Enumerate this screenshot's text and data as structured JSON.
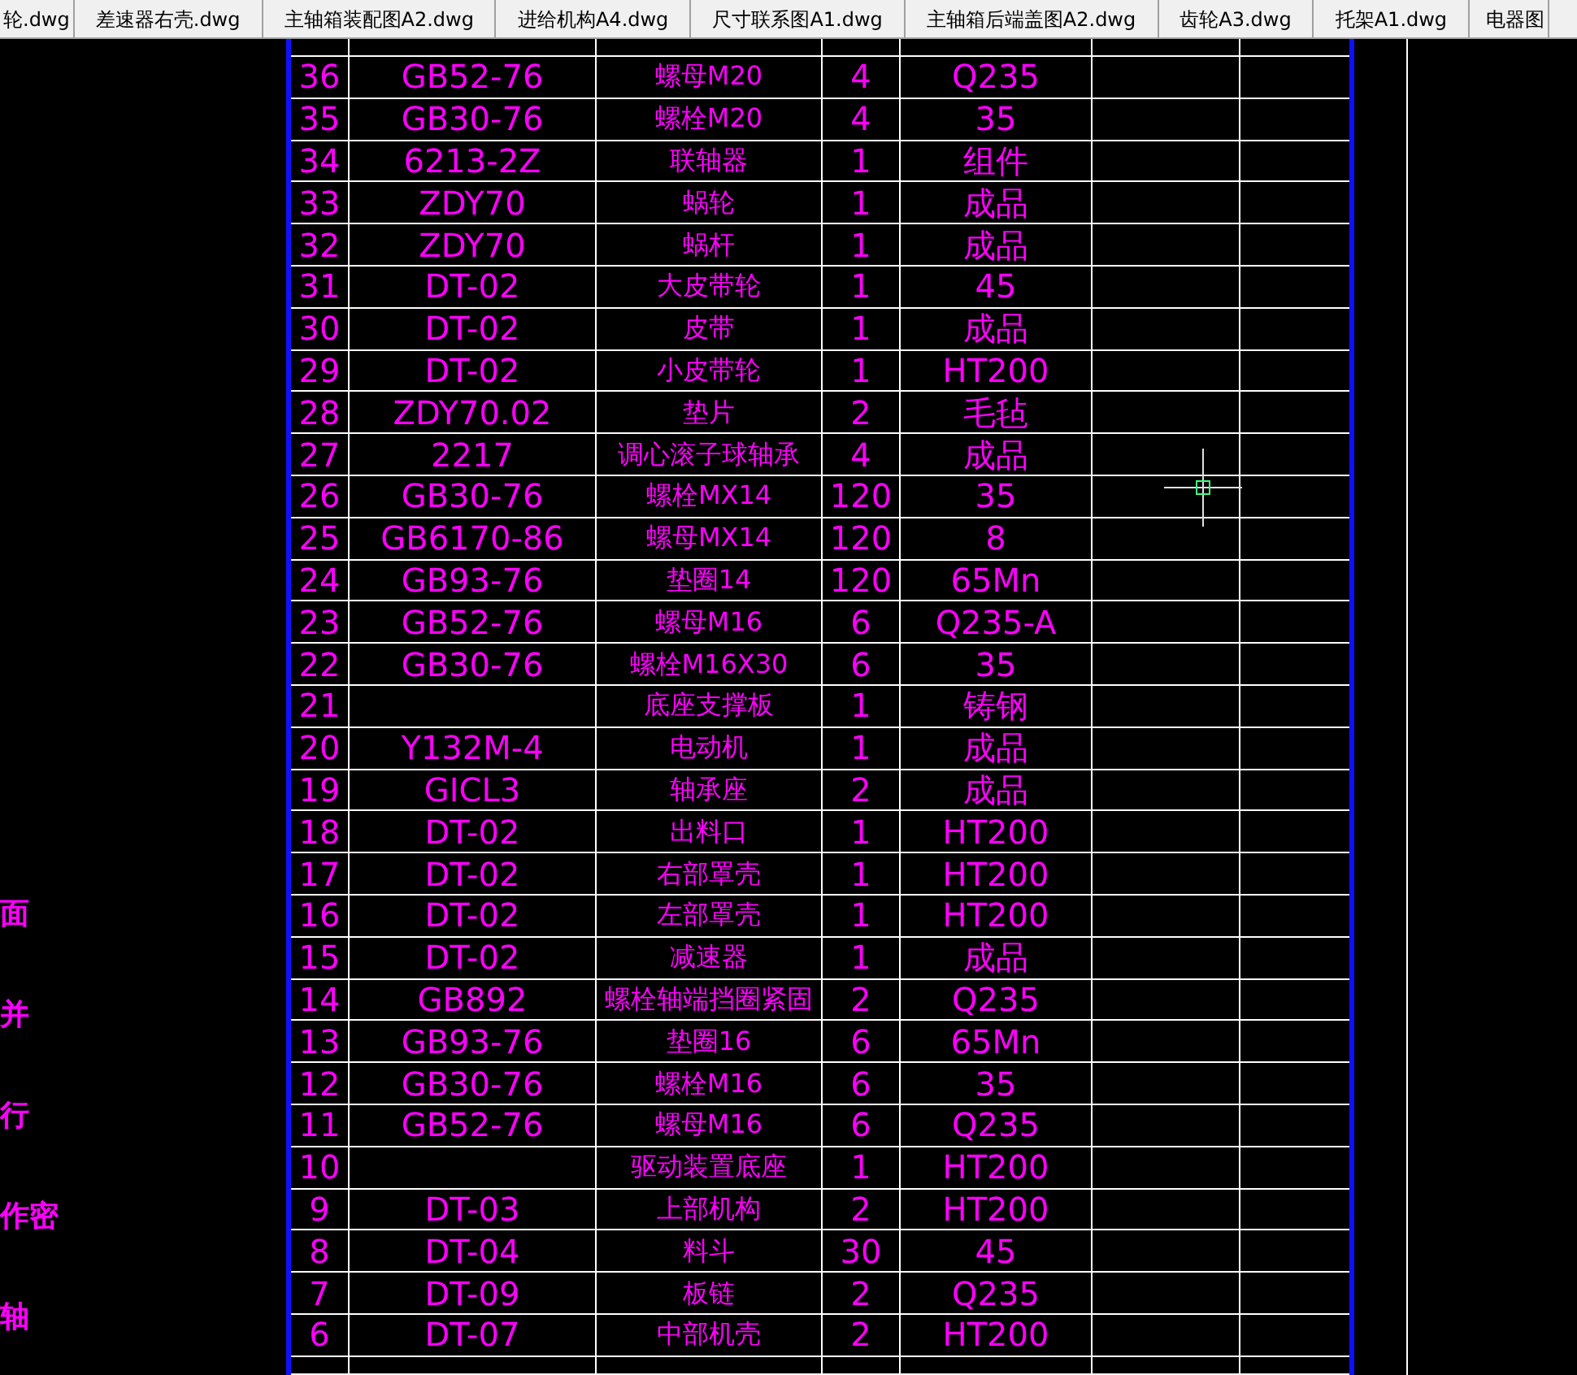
{
  "tabs": [
    {
      "label": "轮.dwg"
    },
    {
      "label": "差速器右壳.dwg"
    },
    {
      "label": "主轴箱装配图A2.dwg"
    },
    {
      "label": "进给机构A4.dwg"
    },
    {
      "label": "尺寸联系图A1.dwg"
    },
    {
      "label": "主轴箱后端盖图A2.dwg"
    },
    {
      "label": "齿轮A3.dwg"
    },
    {
      "label": "托架A1.dwg"
    },
    {
      "label": "电器图"
    }
  ],
  "margin_texts": [
    "面",
    "并",
    "行",
    "作密",
    "轴"
  ],
  "parts_table": {
    "rows": [
      {
        "no": "36",
        "code": "GB52-76",
        "name": "螺母M20",
        "qty": "4",
        "material": "Q235"
      },
      {
        "no": "35",
        "code": "GB30-76",
        "name": "螺栓M20",
        "qty": "4",
        "material": "35"
      },
      {
        "no": "34",
        "code": "6213-2Z",
        "name": "联轴器",
        "qty": "1",
        "material": "组件"
      },
      {
        "no": "33",
        "code": "ZDY70",
        "name": "蜗轮",
        "qty": "1",
        "material": "成品"
      },
      {
        "no": "32",
        "code": "ZDY70",
        "name": "蜗杆",
        "qty": "1",
        "material": "成品"
      },
      {
        "no": "31",
        "code": "DT-02",
        "name": "大皮带轮",
        "qty": "1",
        "material": "45"
      },
      {
        "no": "30",
        "code": "DT-02",
        "name": "皮带",
        "qty": "1",
        "material": "成品"
      },
      {
        "no": "29",
        "code": "DT-02",
        "name": "小皮带轮",
        "qty": "1",
        "material": "HT200"
      },
      {
        "no": "28",
        "code": "ZDY70.02",
        "name": "垫片",
        "qty": "2",
        "material": "毛毡"
      },
      {
        "no": "27",
        "code": "2217",
        "name": "调心滚子球轴承",
        "qty": "4",
        "material": "成品"
      },
      {
        "no": "26",
        "code": "GB30-76",
        "name": "螺栓MX14",
        "qty": "120",
        "material": "35"
      },
      {
        "no": "25",
        "code": "GB6170-86",
        "name": "螺母MX14",
        "qty": "120",
        "material": "8"
      },
      {
        "no": "24",
        "code": "GB93-76",
        "name": "垫圈14",
        "qty": "120",
        "material": "65Mn"
      },
      {
        "no": "23",
        "code": "GB52-76",
        "name": "螺母M16",
        "qty": "6",
        "material": "Q235-A"
      },
      {
        "no": "22",
        "code": "GB30-76",
        "name": "螺栓M16X30",
        "qty": "6",
        "material": "35"
      },
      {
        "no": "21",
        "name": "底座支撑板",
        "qty": "1",
        "material": "铸钢"
      },
      {
        "no": "20",
        "code": "Y132M-4",
        "name": "电动机",
        "qty": "1",
        "material": "成品"
      },
      {
        "no": "19",
        "code": "GICL3",
        "name": "轴承座",
        "qty": "2",
        "material": "成品"
      },
      {
        "no": "18",
        "code": "DT-02",
        "name": "出料口",
        "qty": "1",
        "material": "HT200"
      },
      {
        "no": "17",
        "code": "DT-02",
        "name": "右部罩壳",
        "qty": "1",
        "material": "HT200"
      },
      {
        "no": "16",
        "code": "DT-02",
        "name": "左部罩壳",
        "qty": "1",
        "material": "HT200"
      },
      {
        "no": "15",
        "code": "DT-02",
        "name": "减速器",
        "qty": "1",
        "material": "成品"
      },
      {
        "no": "14",
        "code": "GB892",
        "name": "螺栓轴端挡圈紧固",
        "qty": "2",
        "material": "Q235"
      },
      {
        "no": "13",
        "code": "GB93-76",
        "name": "垫圈16",
        "qty": "6",
        "material": "65Mn"
      },
      {
        "no": "12",
        "code": "GB30-76",
        "name": "螺栓M16",
        "qty": "6",
        "material": "35"
      },
      {
        "no": "11",
        "code": "GB52-76",
        "name": "螺母M16",
        "qty": "6",
        "material": "Q235"
      },
      {
        "no": "10",
        "name": "驱动装置底座",
        "qty": "1",
        "material": "HT200"
      },
      {
        "no": "9",
        "code": "DT-03",
        "name": "上部机构",
        "qty": "2",
        "material": "HT200"
      },
      {
        "no": "8",
        "code": "DT-04",
        "name": "料斗",
        "qty": "30",
        "material": "45"
      },
      {
        "no": "7",
        "code": "DT-09",
        "name": "板链",
        "qty": "2",
        "material": "Q235"
      },
      {
        "no": "6",
        "code": "DT-07",
        "name": "中部机壳",
        "qty": "2",
        "material": "HT200"
      }
    ]
  }
}
